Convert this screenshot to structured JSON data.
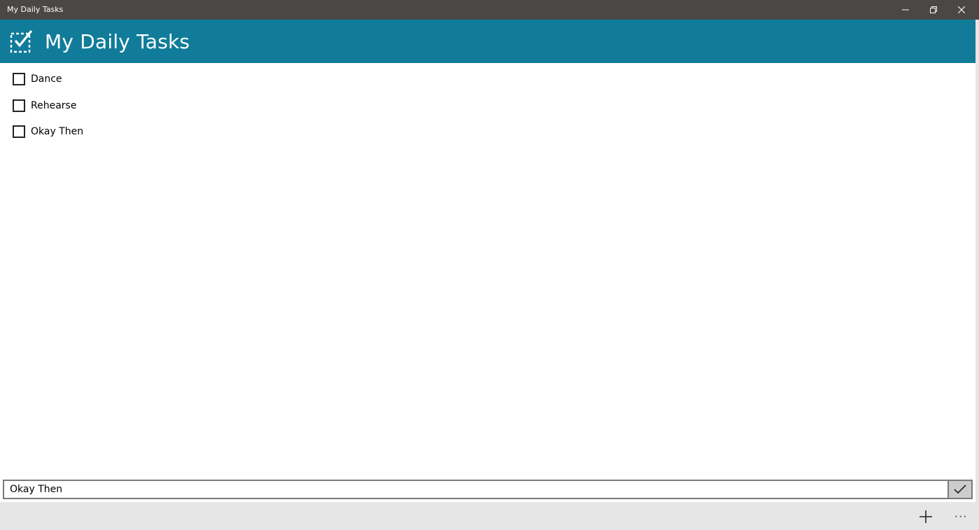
{
  "window": {
    "title": "My Daily Tasks",
    "controls": {
      "minimize_icon": "minimize-icon",
      "maximize_icon": "restore-icon",
      "close_icon": "close-icon"
    }
  },
  "header": {
    "title": "My Daily Tasks",
    "logo_icon": "checklist-icon",
    "background": "#107c99"
  },
  "tasks": [
    {
      "label": "Dance",
      "checked": false
    },
    {
      "label": "Rehearse",
      "checked": false
    },
    {
      "label": "Okay Then",
      "checked": false
    }
  ],
  "input": {
    "value": "Okay Then",
    "submit_icon": "checkmark-icon"
  },
  "command_bar": {
    "add_icon": "plus-icon",
    "more_label": "···"
  }
}
